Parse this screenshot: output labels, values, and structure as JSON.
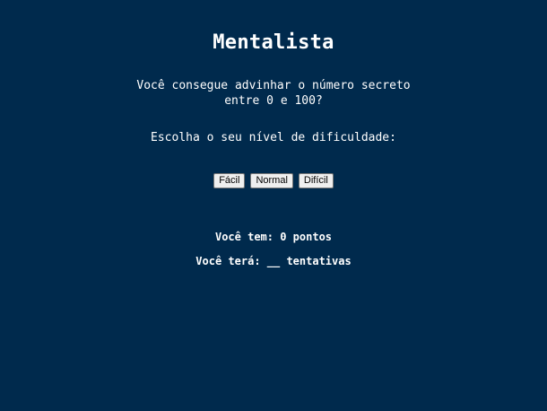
{
  "page": {
    "title": "Mentalista",
    "question_line1": "Você consegue advinhar o número secreto",
    "question_line2": "entre 0 e 100?",
    "difficulty_prompt": "Escolha o seu nível de dificuldade:"
  },
  "buttons": {
    "easy": "Fácil",
    "normal": "Normal",
    "hard": "Difícil"
  },
  "status": {
    "score_text": "Você tem: 0 pontos",
    "attempts_text": "Você terá: __ tentativas"
  },
  "colors": {
    "background": "#002a4d",
    "text": "#ffffff"
  }
}
